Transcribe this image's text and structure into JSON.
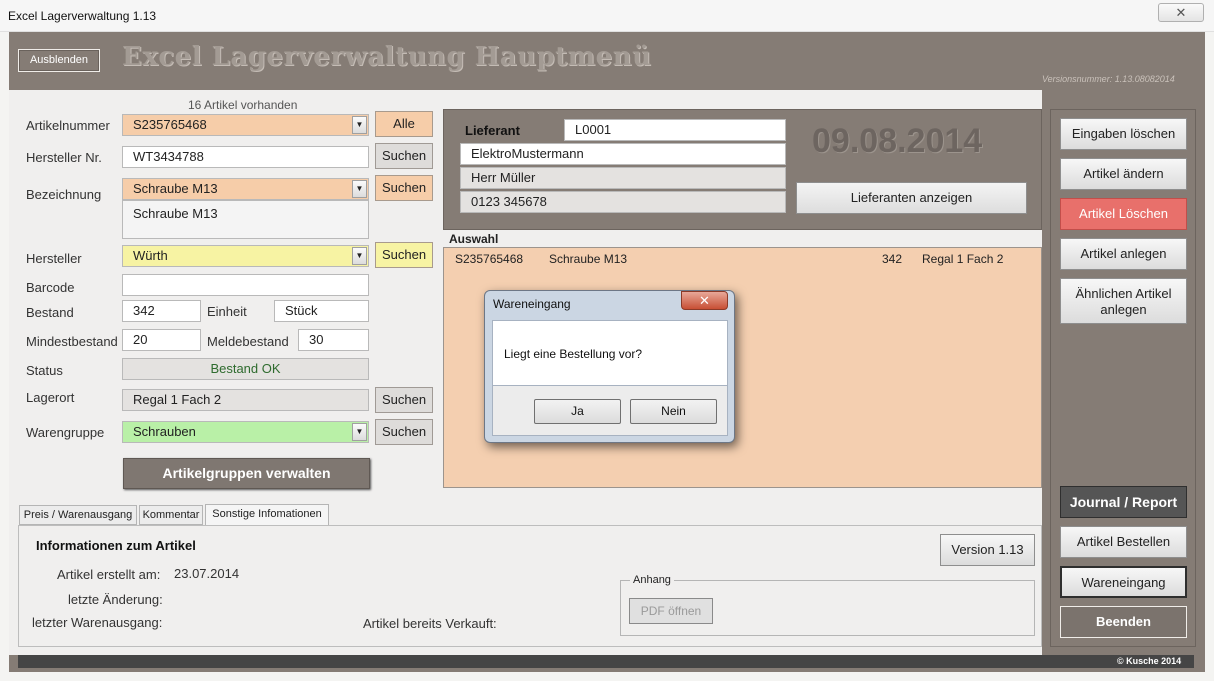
{
  "window": {
    "title": "Excel Lagerverwaltung 1.13",
    "close_glyph": "✕"
  },
  "header": {
    "hide_button": "Ausblenden",
    "title": "Excel Lagerverwaltung Hauptmenü",
    "version_number": "Versionsnummer: 1.13.08082014"
  },
  "article": {
    "count_text": "16 Artikel vorhanden",
    "labels": {
      "article_number": "Artikelnummer",
      "manufacturer_no": "Hersteller Nr.",
      "description": "Bezeichnung",
      "manufacturer": "Hersteller",
      "barcode": "Barcode",
      "stock": "Bestand",
      "unit": "Einheit",
      "min_stock": "Mindestbestand",
      "reorder_stock": "Meldebestand",
      "status": "Status",
      "location": "Lagerort",
      "product_group": "Warengruppe"
    },
    "values": {
      "article_number": "S235765468",
      "manufacturer_no": "WT3434788",
      "description": "Schraube M13",
      "description_text": "Schraube M13",
      "manufacturer": "Würth",
      "barcode": "",
      "stock": "342",
      "unit": "Stück",
      "min_stock": "20",
      "reorder_stock": "30",
      "status": "Bestand OK",
      "location": "Regal 1 Fach 2",
      "product_group": "Schrauben"
    },
    "buttons": {
      "all": "Alle",
      "search": "Suchen",
      "manage_groups": "Artikelgruppen verwalten"
    }
  },
  "supplier": {
    "label": "Lieferant",
    "id": "L0001",
    "name": "ElektroMustermann",
    "contact": "Herr Müller",
    "phone": "0123 345678",
    "date": "09.08.2014",
    "show_button": "Lieferanten anzeigen"
  },
  "selection": {
    "label": "Auswahl",
    "rows": [
      {
        "number": "S235765468",
        "name": "Schraube M13",
        "stock": "342",
        "location": "Regal 1 Fach 2"
      }
    ]
  },
  "actions": {
    "clear_inputs": "Eingaben löschen",
    "edit_article": "Artikel ändern",
    "delete_article": "Artikel Löschen",
    "create_article": "Artikel anlegen",
    "create_similar": "Ähnlichen Artikel anlegen",
    "journal": "Journal / Report",
    "order_article": "Artikel Bestellen",
    "goods_in": "Wareneingang",
    "quit": "Beenden"
  },
  "tabs": [
    {
      "label": "Preis / Warenausgang"
    },
    {
      "label": "Kommentar"
    },
    {
      "label": "Sonstige Infomationen"
    }
  ],
  "info": {
    "title": "Informationen zum Artikel",
    "created_label": "Artikel erstellt am:",
    "created_value": "23.07.2014",
    "changed_label": "letzte Änderung:",
    "last_out_label": "letzter Warenausgang:",
    "sold_label": "Artikel bereits Verkauft:",
    "version_button": "Version 1.13",
    "attachment_label": "Anhang",
    "pdf_button": "PDF öffnen"
  },
  "footer": {
    "copyright": "© Kusche 2014"
  },
  "dialog": {
    "title": "Wareneingang",
    "message": "Liegt eine Bestellung vor?",
    "yes": "Ja",
    "no": "Nein",
    "close_glyph": "✕"
  },
  "colors": {
    "frame": "#857c75",
    "orange_field": "#f6cda9",
    "yellow_field": "#f7f3a3",
    "green_field": "#b9f0a7",
    "delete_button": "#e8706b"
  },
  "icons": {
    "dropdown": "▼"
  }
}
